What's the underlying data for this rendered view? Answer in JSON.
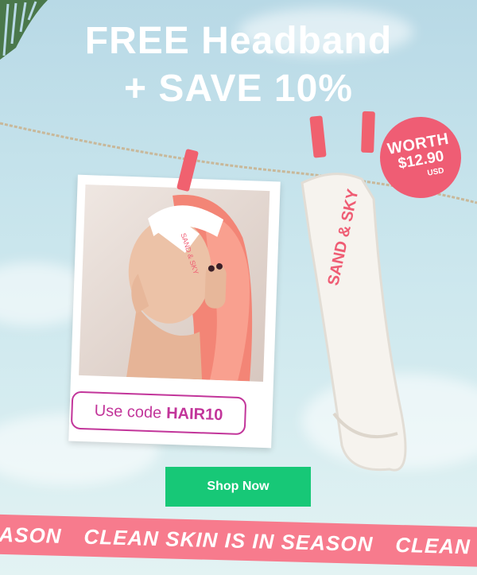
{
  "headline": {
    "line1": "FREE Headband",
    "line2": "+ SAVE 10%"
  },
  "polaroid": {
    "code_prefix": "Use code",
    "code": "HAIR10",
    "headband_print": "SAND & SKY"
  },
  "badge": {
    "worth": "WORTH",
    "price": "$12.90",
    "currency": "USD"
  },
  "headband": {
    "print": "SAND & SKY"
  },
  "cta": {
    "label": "Shop Now"
  },
  "ribbon": {
    "segments": [
      "EASON",
      "CLEAN SKIN IS IN SEASON",
      "CLEAN"
    ]
  },
  "colors": {
    "pink": "#f77b8d",
    "magenta": "#c2359a",
    "green": "#17c877",
    "pin": "#f0616f"
  }
}
